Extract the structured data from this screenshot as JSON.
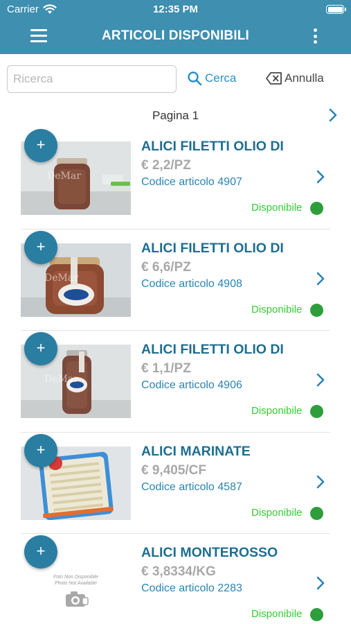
{
  "status_bar": {
    "carrier": "Carrier",
    "time": "12:35 PM"
  },
  "header": {
    "title": "ARTICOLI DISPONIBILI"
  },
  "search": {
    "placeholder": "Ricerca",
    "search_label": "Cerca",
    "cancel_label": "Annulla"
  },
  "pager": {
    "label": "Pagina 1"
  },
  "colors": {
    "accent": "#3e8fb0",
    "title_blue": "#1e6e91",
    "available_green": "#33cc33"
  },
  "items": [
    {
      "name": "ALICI FILETTI OLIO DI",
      "price": "€ 2,2/PZ",
      "code": "Codice articolo 4907",
      "status": "Disponibile",
      "add": "+"
    },
    {
      "name": "ALICI FILETTI OLIO DI",
      "price": "€ 6,6/PZ",
      "code": "Codice articolo 4908",
      "status": "Disponibile",
      "add": "+"
    },
    {
      "name": "ALICI FILETTI OLIO DI",
      "price": "€ 1,1/PZ",
      "code": "Codice articolo 4906",
      "status": "Disponibile",
      "add": "+"
    },
    {
      "name": "ALICI MARINATE",
      "price": "€ 9,405/CF",
      "code": "Codice articolo 4587",
      "status": "Disponibile",
      "add": "+"
    },
    {
      "name": "ALICI MONTEROSSO",
      "price": "€ 3,8334/KG",
      "code": "Codice articolo 2283",
      "status": "Disponibile",
      "add": "+",
      "no_photo": {
        "line1": "Foto Non Disponibile",
        "line2": "Photo Not Available"
      }
    }
  ]
}
